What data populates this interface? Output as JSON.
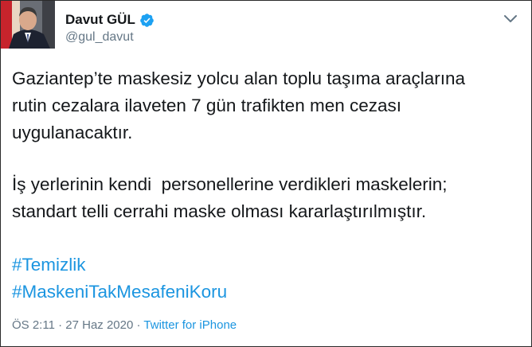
{
  "author": {
    "display_name": "Davut GÜL",
    "handle": "@gul_davut"
  },
  "icons": {
    "verified": "verified-badge-icon",
    "caret": "chevron-down-icon"
  },
  "tweet": {
    "paragraph1": [
      "Gaziantep’te maskesiz yolcu alan toplu taşıma araçlarına",
      "rutin cezalara ilaveten 7 gün trafikten men cezası",
      "uygulanacaktır."
    ],
    "paragraph2": [
      "İş yerlerinin kendi  personellerine verdikleri maskelerin;",
      "standart telli cerrahi maske olması kararlaştırılmıştır."
    ],
    "hashtags": [
      "#Temizlik",
      "#MaskeniTakMesafeniKoru"
    ]
  },
  "meta": {
    "time": "ÖS 2:11",
    "separator1": " · ",
    "date": "27 Haz 2020",
    "separator2": " · ",
    "source": "Twitter for iPhone"
  },
  "colors": {
    "link": "#1b95e0",
    "text": "#14171a",
    "secondary": "#657786",
    "verified": "#1da1f2"
  }
}
